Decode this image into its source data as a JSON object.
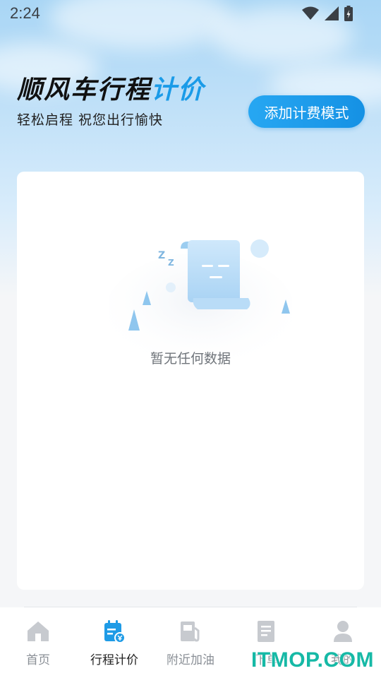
{
  "status_bar": {
    "time": "2:24"
  },
  "header": {
    "title_main": "顺风车行程",
    "title_accent": "计价",
    "subtitle": "轻松启程 祝您出行愉快",
    "add_button_label": "添加计费模式"
  },
  "empty_state": {
    "text": "暂无任何数据"
  },
  "tabbar": {
    "tabs": [
      {
        "label": "首页",
        "icon": "home-icon"
      },
      {
        "label": "行程计价",
        "icon": "trip-calendar-icon",
        "active": true
      },
      {
        "label": "附近加油",
        "icon": "fuel-pump-icon"
      },
      {
        "label": "下单",
        "icon": "order-document-icon"
      },
      {
        "label": "我的",
        "icon": "user-icon"
      }
    ]
  },
  "watermark": "ITMOP.COM",
  "colors": {
    "accent": "#1a9be8",
    "tab_active": "#1e9be6",
    "tab_inactive": "#c7cacf"
  }
}
